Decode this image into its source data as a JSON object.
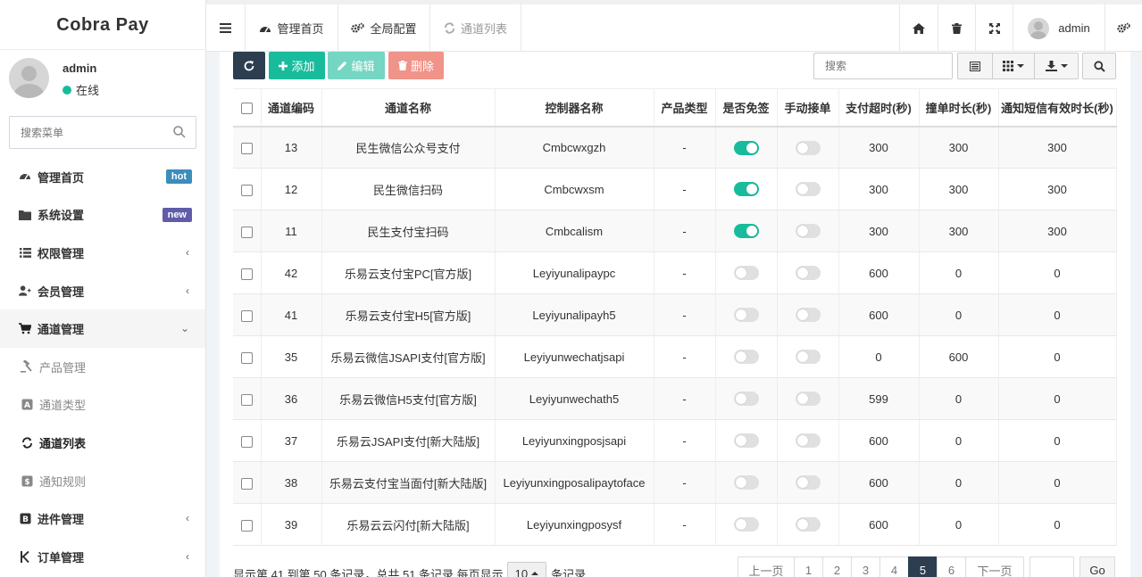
{
  "brand": {
    "name": "Cobra Pay"
  },
  "user": {
    "name": "admin",
    "status": "在线"
  },
  "search_menu": {
    "placeholder": "搜索菜单"
  },
  "menu": {
    "dashboard": {
      "label": "管理首页",
      "badge": "hot"
    },
    "system": {
      "label": "系统设置",
      "badge": "new"
    },
    "auth": {
      "label": "权限管理"
    },
    "member": {
      "label": "会员管理"
    },
    "channel": {
      "label": "通道管理"
    },
    "product": {
      "label": "产品管理"
    },
    "channel_type": {
      "label": "通道类型"
    },
    "channel_list": {
      "label": "通道列表"
    },
    "notify_rule": {
      "label": "通知规则"
    },
    "plugin": {
      "label": "进件管理"
    },
    "order": {
      "label": "订单管理"
    }
  },
  "topbar": {
    "tabs": [
      {
        "label": "管理首页"
      },
      {
        "label": "全局配置"
      },
      {
        "label": "通道列表"
      }
    ],
    "user": "admin"
  },
  "toolbar": {
    "add": "添加",
    "edit": "编辑",
    "delete": "删除",
    "search_placeholder": "搜索"
  },
  "table": {
    "headers": [
      "通道编码",
      "通道名称",
      "控制器名称",
      "产品类型",
      "是否免签",
      "手动接单",
      "支付超时(秒)",
      "撞单时长(秒)",
      "通知短信有效时长(秒)"
    ],
    "rows": [
      {
        "code": "13",
        "name": "民生微信公众号支付",
        "controller": "Cmbcwxgzh",
        "ptype": "-",
        "free": true,
        "manual": false,
        "timeout": "300",
        "collide": "300",
        "sms": "300"
      },
      {
        "code": "12",
        "name": "民生微信扫码",
        "controller": "Cmbcwxsm",
        "ptype": "-",
        "free": true,
        "manual": false,
        "timeout": "300",
        "collide": "300",
        "sms": "300"
      },
      {
        "code": "11",
        "name": "民生支付宝扫码",
        "controller": "Cmbcalism",
        "ptype": "-",
        "free": true,
        "manual": false,
        "timeout": "300",
        "collide": "300",
        "sms": "300"
      },
      {
        "code": "42",
        "name": "乐易云支付宝PC[官方版]",
        "controller": "Leyiyunalipaypc",
        "ptype": "-",
        "free": false,
        "manual": false,
        "timeout": "600",
        "collide": "0",
        "sms": "0"
      },
      {
        "code": "41",
        "name": "乐易云支付宝H5[官方版]",
        "controller": "Leyiyunalipayh5",
        "ptype": "-",
        "free": false,
        "manual": false,
        "timeout": "600",
        "collide": "0",
        "sms": "0"
      },
      {
        "code": "35",
        "name": "乐易云微信JSAPI支付[官方版]",
        "controller": "Leyiyunwechatjsapi",
        "ptype": "-",
        "free": false,
        "manual": false,
        "timeout": "0",
        "collide": "600",
        "sms": "0"
      },
      {
        "code": "36",
        "name": "乐易云微信H5支付[官方版]",
        "controller": "Leyiyunwechath5",
        "ptype": "-",
        "free": false,
        "manual": false,
        "timeout": "599",
        "collide": "0",
        "sms": "0"
      },
      {
        "code": "37",
        "name": "乐易云JSAPI支付[新大陆版]",
        "controller": "Leyiyunxingposjsapi",
        "ptype": "-",
        "free": false,
        "manual": false,
        "timeout": "600",
        "collide": "0",
        "sms": "0"
      },
      {
        "code": "38",
        "name": "乐易云支付宝当面付[新大陆版]",
        "controller": "Leyiyunxingposalipaytoface",
        "ptype": "-",
        "free": false,
        "manual": false,
        "timeout": "600",
        "collide": "0",
        "sms": "0"
      },
      {
        "code": "39",
        "name": "乐易云云闪付[新大陆版]",
        "controller": "Leyiyunxingposysf",
        "ptype": "-",
        "free": false,
        "manual": false,
        "timeout": "600",
        "collide": "0",
        "sms": "0"
      }
    ]
  },
  "footer": {
    "info": "显示第 41 到第 50 条记录，总共 51 条记录 每页显示",
    "page_size": "10",
    "suffix": "条记录",
    "prev": "上一页",
    "pages": [
      "1",
      "2",
      "3",
      "4",
      "5",
      "6"
    ],
    "next": "下一页",
    "go": "Go"
  },
  "colors": {
    "primary": "#18bc9c",
    "dark": "#2c3e50",
    "danger": "#e74c3c",
    "hot": "#3c8dbc",
    "new": "#605ca8"
  }
}
